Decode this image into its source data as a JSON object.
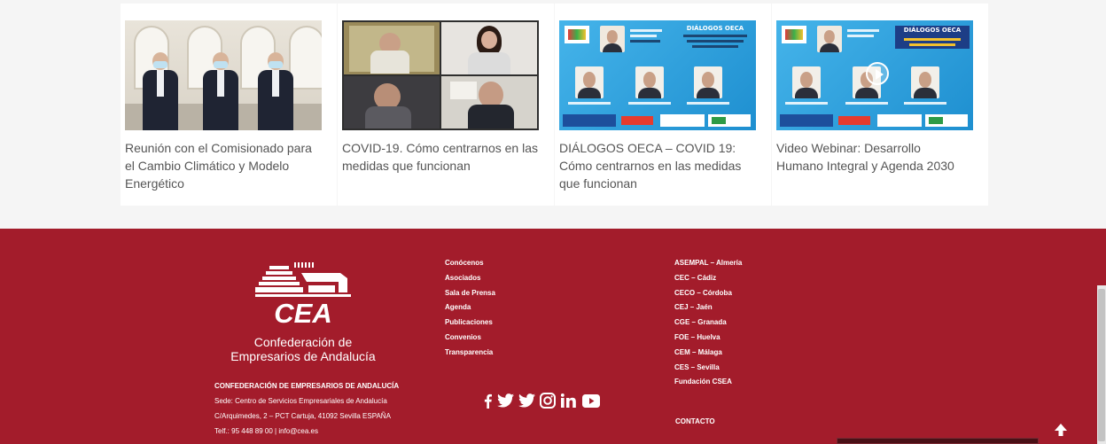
{
  "news": {
    "cards": [
      {
        "title_lines": [
          "Reunión con el Comisionado para",
          "el Cambio Climático y Modelo",
          "Energético"
        ],
        "image": "photo-officials-masks"
      },
      {
        "title_lines": [
          "COVID-19. Cómo centrarnos en las",
          "medidas que funcionan"
        ],
        "image": "photo-video-call"
      },
      {
        "title_lines": [
          "DIÁLOGOS OECA – COVID 19:",
          "Cómo centrarnos en las medidas",
          "que funcionan"
        ],
        "image": "poster-dialogos-oeca-covid"
      },
      {
        "title_lines": [
          "Video Webinar: Desarrollo",
          "Humano Integral y Agenda 2030"
        ],
        "image": "poster-dialogos-oeca-webinar"
      }
    ]
  },
  "footer": {
    "background": "#a31c2b",
    "logo": {
      "acronym": "CEA",
      "line1": "Confederación de",
      "line2": "Empresarios de Andalucía"
    },
    "address": {
      "org": "CONFEDERACIÓN DE EMPRESARIOS DE ANDALUCÍA",
      "sede": "Sede: Centro de Servicios Empresariales de Andalucía",
      "street": "C/Arquimedes, 2 – PCT Cartuja, 41092 Sevilla ESPAÑA",
      "contact": "Telf.: 95 448 89 00 | info@cea.es"
    },
    "menu": [
      "Conócenos",
      "Asociados",
      "Sala de Prensa",
      "Agenda",
      "Publicaciones",
      "Convenios",
      "Transparencia"
    ],
    "members": [
      "ASEMPAL – Almería",
      "CEC – Cádiz",
      "CECO – Córdoba",
      "CEJ – Jaén",
      "CGE – Granada",
      "FOE – Huelva",
      "CEM – Málaga",
      "CES – Sevilla",
      "Fundación CSEA"
    ],
    "social_icons": [
      "facebook-icon",
      "twitter-icon",
      "twitter-icon",
      "instagram-icon",
      "linkedin-icon",
      "youtube-icon"
    ],
    "contact_label": "CONTACTO"
  }
}
